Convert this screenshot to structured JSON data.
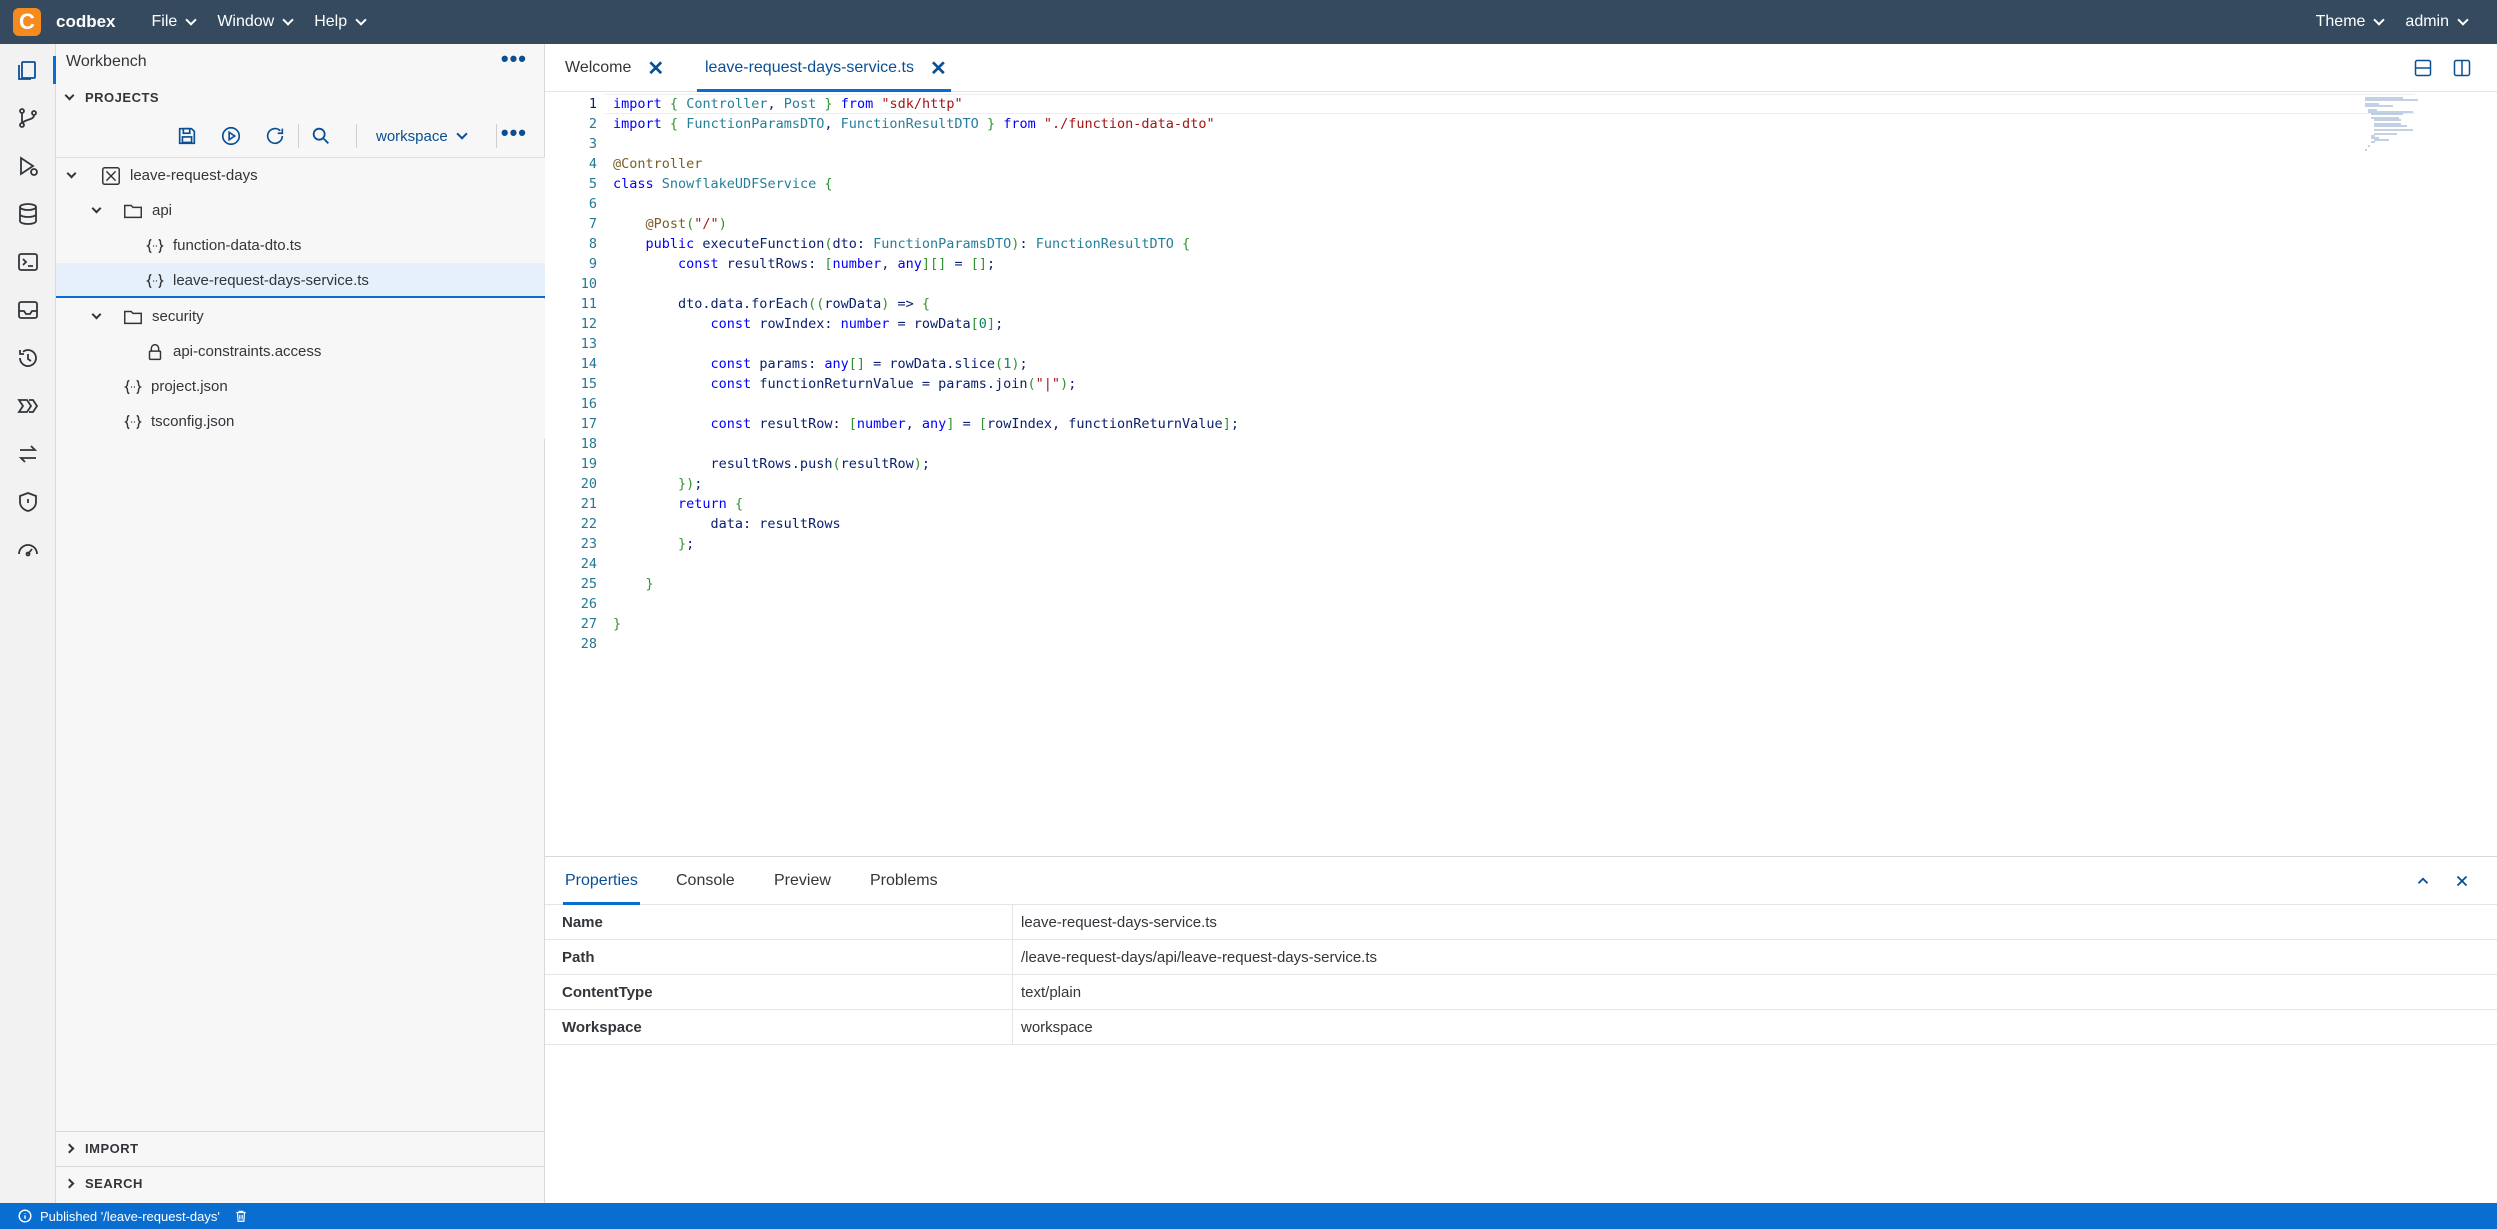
{
  "app": {
    "brand": "codbex",
    "logo_letter": "C"
  },
  "menus": [
    "File",
    "Window",
    "Help"
  ],
  "right_menus": [
    "Theme",
    "admin"
  ],
  "activity_icons": [
    "workbench-icon",
    "git-icon",
    "debug-icon",
    "database-icon",
    "terminal-icon",
    "inbox-icon",
    "history-icon",
    "pipeline-icon",
    "transfer-icon",
    "security-icon",
    "dashboard-icon"
  ],
  "sidebar": {
    "title": "Workbench",
    "projects_label": "PROJECTS",
    "workspace": "workspace",
    "import_label": "IMPORT",
    "search_label": "SEARCH",
    "tree": [
      {
        "label": "leave-request-days",
        "kind": "project"
      },
      {
        "label": "api",
        "kind": "folder"
      },
      {
        "label": "function-data-dto.ts",
        "kind": "file"
      },
      {
        "label": "leave-request-days-service.ts",
        "kind": "file",
        "selected": true
      },
      {
        "label": "security",
        "kind": "folder"
      },
      {
        "label": "api-constraints.access",
        "kind": "lock"
      },
      {
        "label": "project.json",
        "kind": "file"
      },
      {
        "label": "tsconfig.json",
        "kind": "file"
      }
    ]
  },
  "editor": {
    "tabs": [
      {
        "label": "Welcome",
        "close": "✕"
      },
      {
        "label": "leave-request-days-service.ts",
        "close": "✕",
        "active": true
      }
    ],
    "line_numbers": [
      "1",
      "2",
      "3",
      "4",
      "5",
      "6",
      "7",
      "8",
      "9",
      "10",
      "11",
      "12",
      "13",
      "14",
      "15",
      "16",
      "17",
      "18",
      "19",
      "20",
      "21",
      "22",
      "23",
      "24",
      "25",
      "26",
      "27",
      "28"
    ]
  },
  "bottom": {
    "tabs": [
      "Properties",
      "Console",
      "Preview",
      "Problems"
    ],
    "properties": [
      {
        "key": "Name",
        "value": "leave-request-days-service.ts"
      },
      {
        "key": "Path",
        "value": "/leave-request-days/api/leave-request-days-service.ts"
      },
      {
        "key": "ContentType",
        "value": "text/plain"
      },
      {
        "key": "Workspace",
        "value": "workspace"
      }
    ]
  },
  "status": {
    "message": "Published '/leave-request-days'"
  },
  "colors": {
    "topbar": "#354a5f",
    "accent": "#0a6ed1",
    "logo": "#f58b1f",
    "statusbar": "#0a6ed1"
  }
}
